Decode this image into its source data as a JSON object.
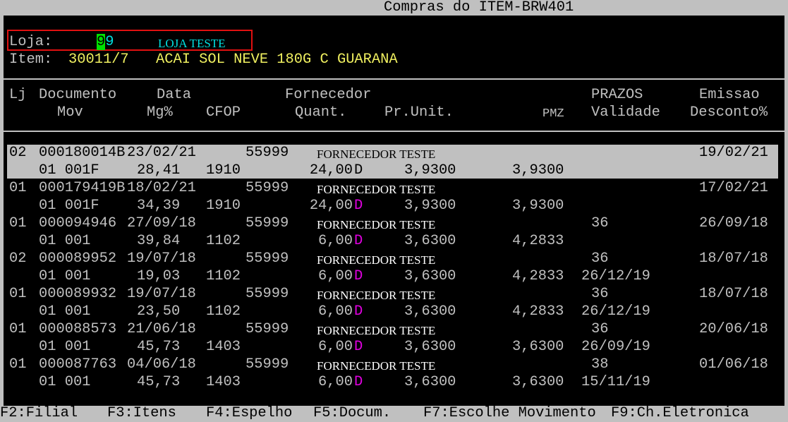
{
  "window": {
    "title": "Compras do ITEM-BRW401"
  },
  "header": {
    "loja_label": "Loja:",
    "loja_value_cursor": "9",
    "loja_value_rest": "9",
    "loja_name": "LOJA TESTE",
    "item_label": "Item:",
    "item_code": "30011/7",
    "item_desc": "ACAI SOL NEVE 180G C GUARANA"
  },
  "columns": {
    "lj": "Lj",
    "documento": "Documento",
    "data": "Data",
    "fornecedor": "Fornecedor",
    "prazos": "PRAZOS",
    "emissao": "Emissao",
    "mov": "Mov",
    "mg": "Mg%",
    "cfop": "CFOP",
    "quant": "Quant.",
    "prunit": "Pr.Unit.",
    "pmz": "PMZ",
    "validade": "Validade",
    "desconto": "Desconto%"
  },
  "rows": [
    {
      "lj": "02",
      "doc": "000180014B",
      "data": "23/02/21",
      "code": "55999",
      "fornecedor": "FORNECEDOR TESTE",
      "prazo": "",
      "emissao": "19/02/21",
      "mov": "01 001F",
      "mg": "28,41",
      "cfop": "1910",
      "quant": "24,00",
      "unit": "D",
      "prunit": "3,9300",
      "pmz": "3,9300",
      "validade": "",
      "desconto": ""
    },
    {
      "lj": "01",
      "doc": "000179419B",
      "data": "18/02/21",
      "code": "55999",
      "fornecedor": "FORNECEDOR TESTE",
      "prazo": "",
      "emissao": "17/02/21",
      "mov": "01 001F",
      "mg": "34,39",
      "cfop": "1910",
      "quant": "24,00",
      "unit": "D",
      "prunit": "3,9300",
      "pmz": "3,9300",
      "validade": "",
      "desconto": ""
    },
    {
      "lj": "01",
      "doc": "000094946",
      "data": "27/09/18",
      "code": "55999",
      "fornecedor": "FORNECEDOR TESTE",
      "prazo": "36",
      "emissao": "26/09/18",
      "mov": "01 001",
      "mg": "39,84",
      "cfop": "1102",
      "quant": "6,00",
      "unit": "D",
      "prunit": "3,6300",
      "pmz": "4,2833",
      "validade": "",
      "desconto": ""
    },
    {
      "lj": "02",
      "doc": "000089952",
      "data": "19/07/18",
      "code": "55999",
      "fornecedor": "FORNECEDOR TESTE",
      "prazo": "36",
      "emissao": "18/07/18",
      "mov": "01 001",
      "mg": "19,03",
      "cfop": "1102",
      "quant": "6,00",
      "unit": "D",
      "prunit": "3,6300",
      "pmz": "4,2833",
      "validade": "26/12/19",
      "desconto": ""
    },
    {
      "lj": "01",
      "doc": "000089932",
      "data": "19/07/18",
      "code": "55999",
      "fornecedor": "FORNECEDOR TESTE",
      "prazo": "36",
      "emissao": "18/07/18",
      "mov": "01 001",
      "mg": "23,50",
      "cfop": "1102",
      "quant": "6,00",
      "unit": "D",
      "prunit": "3,6300",
      "pmz": "4,2833",
      "validade": "26/12/19",
      "desconto": ""
    },
    {
      "lj": "01",
      "doc": "000088573",
      "data": "21/06/18",
      "code": "55999",
      "fornecedor": "FORNECEDOR TESTE",
      "prazo": "36",
      "emissao": "20/06/18",
      "mov": "01 001",
      "mg": "45,73",
      "cfop": "1403",
      "quant": "6,00",
      "unit": "D",
      "prunit": "3,6300",
      "pmz": "3,6300",
      "validade": "26/09/19",
      "desconto": ""
    },
    {
      "lj": "01",
      "doc": "000087763",
      "data": "04/06/18",
      "code": "55999",
      "fornecedor": "FORNECEDOR TESTE",
      "prazo": "38",
      "emissao": "01/06/18",
      "mov": "01 001",
      "mg": "45,73",
      "cfop": "1403",
      "quant": "6,00",
      "unit": "D",
      "prunit": "3,6300",
      "pmz": "3,6300",
      "validade": "15/11/19",
      "desconto": ""
    }
  ],
  "fkeys": [
    "F2:Filial",
    "F3:Itens",
    "F4:Espelho",
    "F5:Docum.",
    "F7:Escolhe Movimento",
    "F9:Ch.Eletronica"
  ],
  "colors": {
    "background": "#000000",
    "selection": "#c0c0c0",
    "highlight_box": "#e01010",
    "cursor": "#00e000",
    "unit_accent": "#e000e0"
  }
}
